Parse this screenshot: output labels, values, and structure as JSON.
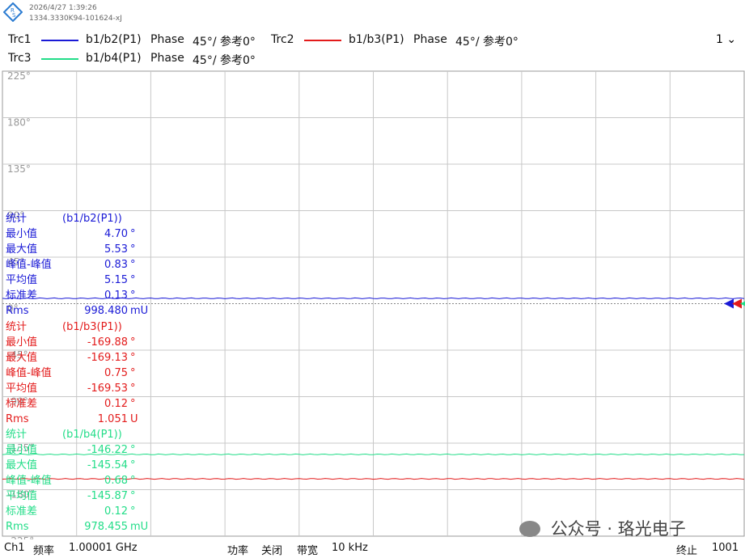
{
  "header": {
    "timestamp": "2026/4/27 1:39:26",
    "instrument_id": "1334.3330K94-101624-xJ"
  },
  "traces": [
    {
      "name": "Trc1",
      "color": "#1a1ad6",
      "meas": "b1/b2(P1)",
      "format": "Phase",
      "scale": "45°/ 参考0°"
    },
    {
      "name": "Trc2",
      "color": "#e31b1b",
      "meas": "b1/b3(P1)",
      "format": "Phase",
      "scale": "45°/ 参考0°"
    },
    {
      "name": "Trc3",
      "color": "#22dd88",
      "meas": "b1/b4(P1)",
      "format": "Phase",
      "scale": "45°/ 参考0°"
    }
  ],
  "channel_selector": "1",
  "chart_data": {
    "type": "line",
    "y_tick_labels": [
      "225°",
      "180°",
      "135°",
      "90°",
      "45°",
      "0°",
      "-45°",
      "-90°",
      "-135°",
      "-180°",
      "-225°"
    ],
    "ylim": [
      -225,
      225
    ],
    "y_unit": "°",
    "grid": true,
    "x_points": 1001,
    "series": [
      {
        "name": "b1/b2(P1)",
        "mean": 5.15,
        "color": "#1a1ad6"
      },
      {
        "name": "b1/b3(P1)",
        "mean": -169.53,
        "color": "#e31b1b"
      },
      {
        "name": "b1/b4(P1)",
        "mean": -145.87,
        "color": "#22dd88"
      }
    ]
  },
  "stats_blocks": [
    {
      "color": "#1a1ad6",
      "header": "统计",
      "trace": "(b1/b2(P1))",
      "rows": [
        {
          "label": "最小值",
          "value": "4.70",
          "unit": "°"
        },
        {
          "label": "最大值",
          "value": "5.53",
          "unit": "°"
        },
        {
          "label": "峰值-峰值",
          "value": "0.83",
          "unit": "°"
        },
        {
          "label": "平均值",
          "value": "5.15",
          "unit": "°"
        },
        {
          "label": "标准差",
          "value": "0.13",
          "unit": "°"
        },
        {
          "label": "Rms",
          "value": "998.480",
          "unit": "mU"
        }
      ]
    },
    {
      "color": "#e31b1b",
      "header": "统计",
      "trace": "(b1/b3(P1))",
      "rows": [
        {
          "label": "最小值",
          "value": "-169.88",
          "unit": "°"
        },
        {
          "label": "最大值",
          "value": "-169.13",
          "unit": "°"
        },
        {
          "label": "峰值-峰值",
          "value": "0.75",
          "unit": "°"
        },
        {
          "label": "平均值",
          "value": "-169.53",
          "unit": "°"
        },
        {
          "label": "标准差",
          "value": "0.12",
          "unit": "°"
        },
        {
          "label": "Rms",
          "value": "1.051",
          "unit": "U"
        }
      ]
    },
    {
      "color": "#22dd88",
      "header": "统计",
      "trace": "(b1/b4(P1))",
      "rows": [
        {
          "label": "最小值",
          "value": "-146.22",
          "unit": "°"
        },
        {
          "label": "最大值",
          "value": "-145.54",
          "unit": "°"
        },
        {
          "label": "峰值-峰值",
          "value": "0.68",
          "unit": "°"
        },
        {
          "label": "平均值",
          "value": "-145.87",
          "unit": "°"
        },
        {
          "label": "标准差",
          "value": "0.12",
          "unit": "°"
        },
        {
          "label": "Rms",
          "value": "978.455",
          "unit": "mU"
        }
      ]
    }
  ],
  "footer": {
    "channel": "Ch1",
    "freq_label": "频率",
    "freq_value": "1.00001 GHz",
    "power_label": "功率",
    "power_value": "关闭",
    "bw_label": "带宽",
    "bw_value": "10 kHz",
    "stop_label": "终止",
    "stop_value": "1001"
  },
  "watermark": "公众号 · 珞光电子"
}
